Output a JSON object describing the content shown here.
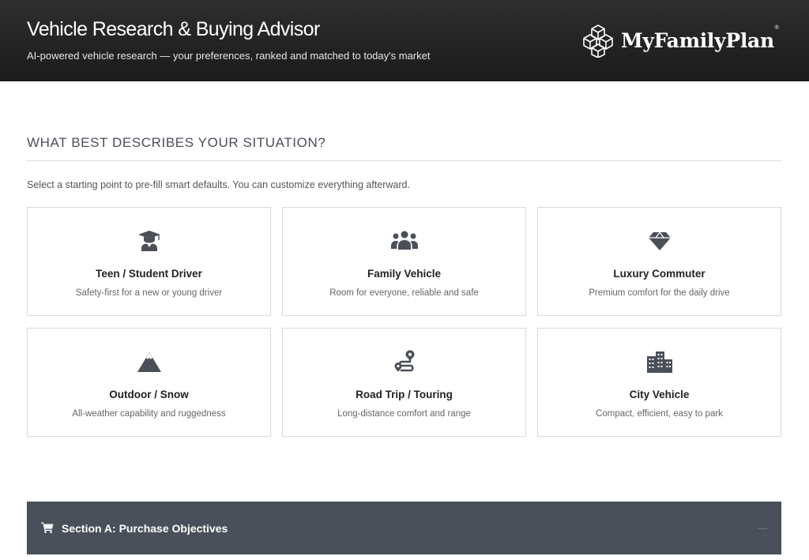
{
  "header": {
    "title": "Vehicle Research & Buying Advisor",
    "subtitle": "AI-powered vehicle research — your preferences, ranked and matched to today's market",
    "brand_name": "MyFamilyPlan",
    "brand_registered": "®"
  },
  "situation": {
    "heading": "WHAT BEST DESCRIBES YOUR SITUATION?",
    "instructions": "Select a starting point to pre-fill smart defaults. You can customize everything afterward.",
    "cards": [
      {
        "icon": "graduation-cap-icon",
        "title": "Teen / Student Driver",
        "desc": "Safety-first for a new or young driver"
      },
      {
        "icon": "family-icon",
        "title": "Family Vehicle",
        "desc": "Room for everyone, reliable and safe"
      },
      {
        "icon": "diamond-icon",
        "title": "Luxury Commuter",
        "desc": "Premium comfort for the daily drive"
      },
      {
        "icon": "mountain-icon",
        "title": "Outdoor / Snow",
        "desc": "All-weather capability and ruggedness"
      },
      {
        "icon": "route-icon",
        "title": "Road Trip / Touring",
        "desc": "Long-distance comfort and range"
      },
      {
        "icon": "city-icon",
        "title": "City Vehicle",
        "desc": "Compact, efficient, easy to park"
      }
    ]
  },
  "sections": [
    {
      "icon": "shopping-cart-icon",
      "title": "Section A: Purchase Objectives",
      "toggle_icon": "collapse-dash-icon"
    }
  ],
  "colors": {
    "header_bg": "#222222",
    "accordion_bg": "#4a505a",
    "icon_color": "#4a4f58"
  }
}
